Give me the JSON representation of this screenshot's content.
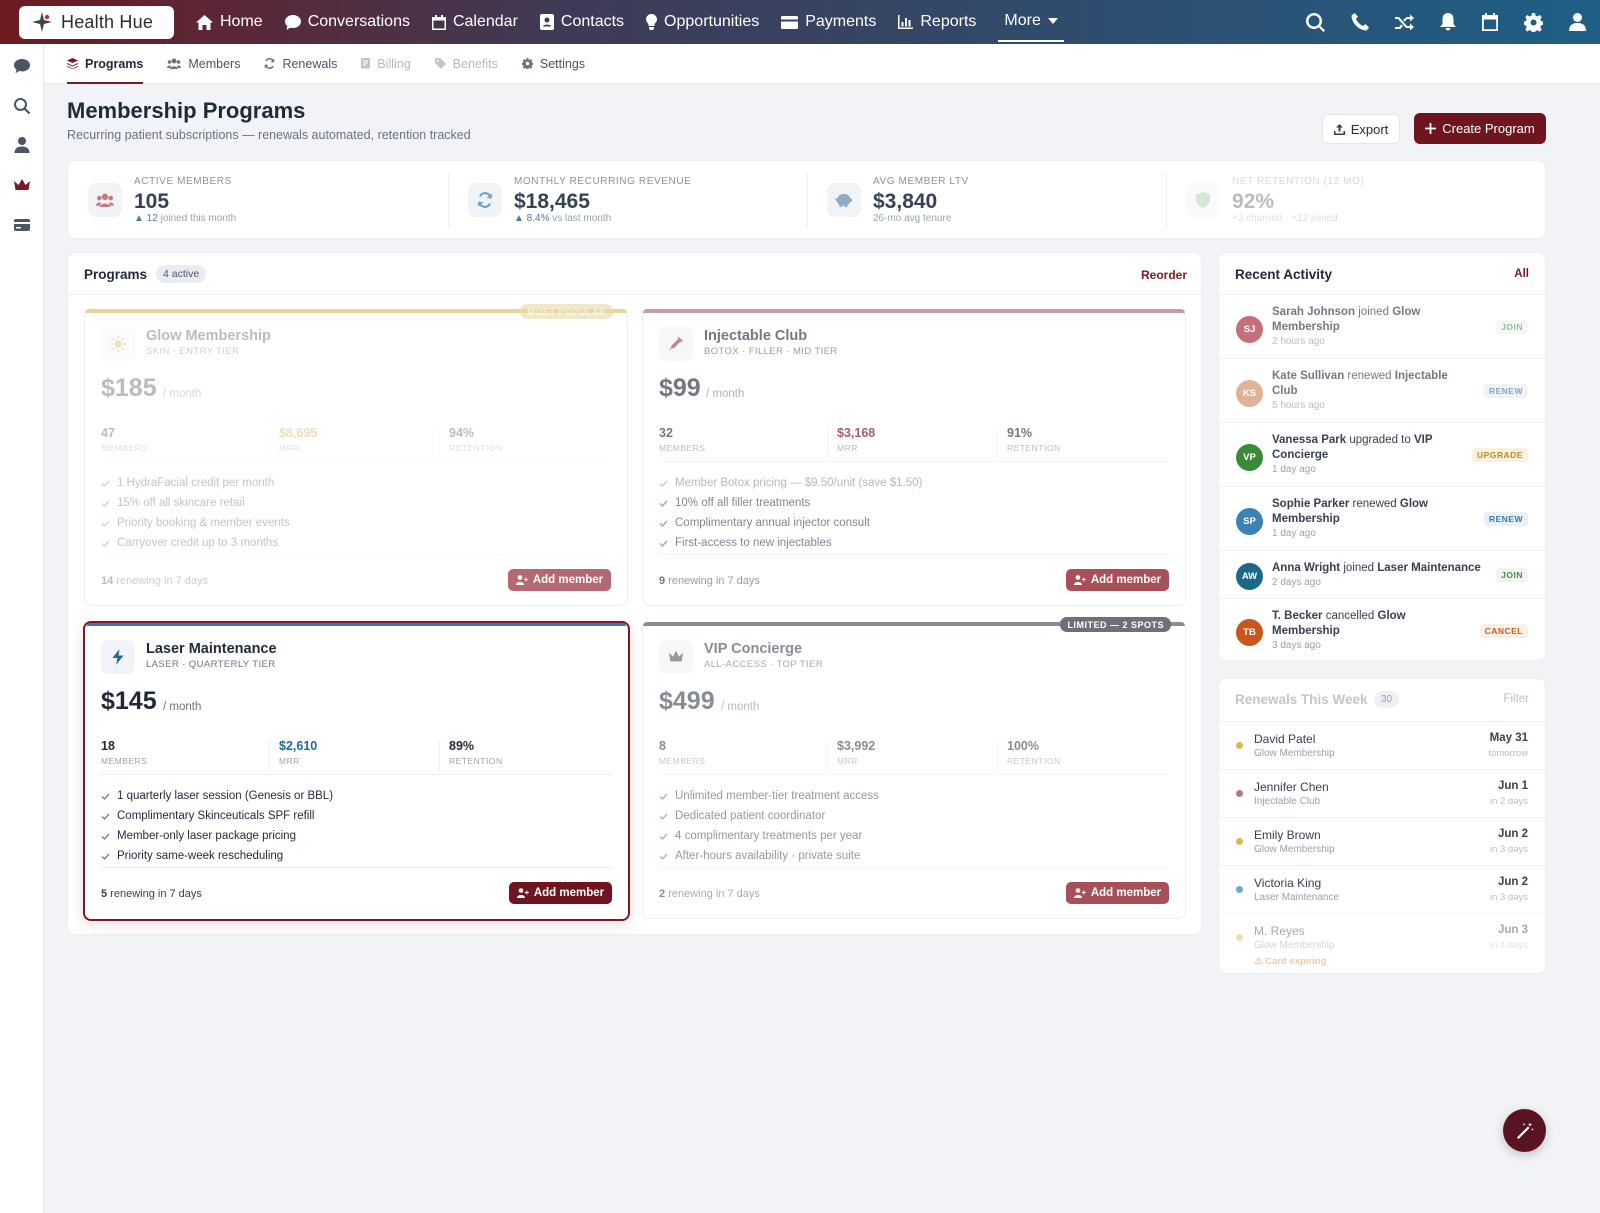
{
  "app": {
    "brand": "Health Hue"
  },
  "nav": {
    "items": [
      {
        "label": "Home",
        "icon": "home-icon"
      },
      {
        "label": "Conversations",
        "icon": "chat-icon"
      },
      {
        "label": "Calendar",
        "icon": "calendar-icon"
      },
      {
        "label": "Contacts",
        "icon": "contacts-icon"
      },
      {
        "label": "Opportunities",
        "icon": "lightbulb-icon"
      },
      {
        "label": "Payments",
        "icon": "credit-card-icon"
      },
      {
        "label": "Reports",
        "icon": "bar-chart-icon"
      }
    ],
    "more_label": "More"
  },
  "subnav": {
    "tabs": [
      {
        "label": "Programs",
        "state": "active"
      },
      {
        "label": "Members",
        "state": "normal"
      },
      {
        "label": "Renewals",
        "state": "normal"
      },
      {
        "label": "Billing",
        "state": "disabled"
      },
      {
        "label": "Benefits",
        "state": "disabled"
      },
      {
        "label": "Settings",
        "state": "normal"
      }
    ]
  },
  "header": {
    "title": "Membership Programs",
    "subtitle": "Recurring patient subscriptions — renewals automated, retention tracked",
    "export_label": "Export",
    "create_label": "Create Program"
  },
  "stats": [
    {
      "label": "ACTIVE MEMBERS",
      "value": "105",
      "sub_strong": "▲ 12",
      "sub": "joined this month"
    },
    {
      "label": "MONTHLY RECURRING REVENUE",
      "value": "$18,465",
      "sub_strong": "▲ 8.4%",
      "sub": "vs last month"
    },
    {
      "label": "AVG MEMBER LTV",
      "value": "$3,840",
      "sub_strong": "",
      "sub": "26-mo avg tenure"
    },
    {
      "label": "NET RETENTION (12 MO)",
      "value": "92%",
      "sub_strong": "",
      "sub": "+3 churned · +12 joined"
    }
  ],
  "programs": {
    "title": "Programs",
    "badge": "4 active",
    "reorder_label": "Reorder",
    "cards": [
      {
        "name": "Glow Membership",
        "tier": "SKIN · ENTRY TIER",
        "price": "$185",
        "per": "/ month",
        "members": "47",
        "mrr": "$8,695",
        "retention": "94%",
        "members_label": "MEMBERS",
        "mrr_label": "MRR",
        "retention_label": "RETENTION",
        "features": [
          "1 HydraFacial credit per month",
          "15% off all skincare retail",
          "Priority booking & member events",
          "Carryover credit up to 3 months"
        ],
        "renew_count": "14",
        "renew_text": "renewing in 7 days",
        "add_label": "Add member",
        "ribbon": "MOST POPULAR",
        "accent": "#d9b65a"
      },
      {
        "name": "Injectable Club",
        "tier": "BOTOX · FILLER · MID TIER",
        "price": "$99",
        "per": "/ month",
        "members": "32",
        "mrr": "$3,168",
        "retention": "91%",
        "members_label": "MEMBERS",
        "mrr_label": "MRR",
        "retention_label": "RETENTION",
        "features": [
          "Member Botox pricing — $9.50/unit (save $1.50)",
          "10% off all filler treatments",
          "Complimentary annual injector consult",
          "First-access to new injectables"
        ],
        "renew_count": "9",
        "renew_text": "renewing in 7 days",
        "add_label": "Add member",
        "ribbon": "",
        "accent": "#b07a80"
      },
      {
        "name": "Laser Maintenance",
        "tier": "LASER · QUARTERLY TIER",
        "price": "$145",
        "per": "/ month",
        "members": "18",
        "mrr": "$2,610",
        "retention": "89%",
        "members_label": "MEMBERS",
        "mrr_label": "MRR",
        "retention_label": "RETENTION",
        "features": [
          "1 quarterly laser session (Genesis or BBL)",
          "Complimentary Skinceuticals SPF refill",
          "Member-only laser package pricing",
          "Priority same-week rescheduling"
        ],
        "renew_count": "5",
        "renew_text": "renewing in 7 days",
        "add_label": "Add member",
        "ribbon": "",
        "accent": "#2f7fa8"
      },
      {
        "name": "VIP Concierge",
        "tier": "ALL-ACCESS · TOP TIER",
        "price": "$499",
        "per": "/ month",
        "members": "8",
        "mrr": "$3,992",
        "retention": "100%",
        "members_label": "MEMBERS",
        "mrr_label": "MRR",
        "retention_label": "RETENTION",
        "features": [
          "Unlimited member-tier treatment access",
          "Dedicated patient coordinator",
          "4 complimentary treatments per year",
          "After-hours availability · private suite"
        ],
        "renew_count": "2",
        "renew_text": "renewing in 7 days",
        "add_label": "Add member",
        "ribbon": "LIMITED — 2 SPOTS",
        "accent": "#8a8f97"
      }
    ]
  },
  "activity": {
    "title": "Recent Activity",
    "all_label": "All",
    "items": [
      {
        "initials": "SJ",
        "color": "#c4707a",
        "name": "Sarah Johnson",
        "verb": "joined",
        "target": "Glow Membership",
        "time": "2 hours ago",
        "tag": "JOIN"
      },
      {
        "initials": "KS",
        "color": "#d4956a",
        "name": "Kate Sullivan",
        "verb": "renewed",
        "target": "Injectable Club",
        "time": "5 hours ago",
        "tag": "RENEW"
      },
      {
        "initials": "VP",
        "color": "#3a8a3a",
        "name": "Vanessa Park",
        "verb": "upgraded to",
        "target": "VIP Concierge",
        "time": "1 day ago",
        "tag": "UPGRADE"
      },
      {
        "initials": "SP",
        "color": "#3d82b4",
        "name": "Sophie Parker",
        "verb": "renewed",
        "target": "Glow Membership",
        "time": "1 day ago",
        "tag": "RENEW"
      },
      {
        "initials": "AW",
        "color": "#1a6a86",
        "name": "Anna Wright",
        "verb": "joined",
        "target": "Laser Maintenance",
        "time": "2 days ago",
        "tag": "JOIN"
      },
      {
        "initials": "TB",
        "color": "#c7571b",
        "name": "T. Becker",
        "verb": "cancelled",
        "target": "Glow Membership",
        "time": "3 days ago",
        "tag": "CANCEL"
      }
    ]
  },
  "renewals": {
    "title": "Renewals This Week",
    "badge": "30",
    "filter_label": "Filter",
    "items": [
      {
        "name": "David Patel",
        "program": "Glow Membership",
        "date": "May 31",
        "rel": "tomorrow",
        "dot": "#d9b65a",
        "warn": ""
      },
      {
        "name": "Jennifer Chen",
        "program": "Injectable Club",
        "date": "Jun 1",
        "rel": "in 2 days",
        "dot": "#b07a80",
        "warn": ""
      },
      {
        "name": "Emily Brown",
        "program": "Glow Membership",
        "date": "Jun 2",
        "rel": "in 3 days",
        "dot": "#d9b65a",
        "warn": ""
      },
      {
        "name": "Victoria King",
        "program": "Laser Maintenance",
        "date": "Jun 2",
        "rel": "in 3 days",
        "dot": "#6fa8cf",
        "warn": ""
      },
      {
        "name": "M. Reyes",
        "program": "Glow Membership",
        "date": "Jun 3",
        "rel": "in 4 days",
        "dot": "#d9b65a",
        "warn": "⚠ Card expiring"
      }
    ]
  }
}
